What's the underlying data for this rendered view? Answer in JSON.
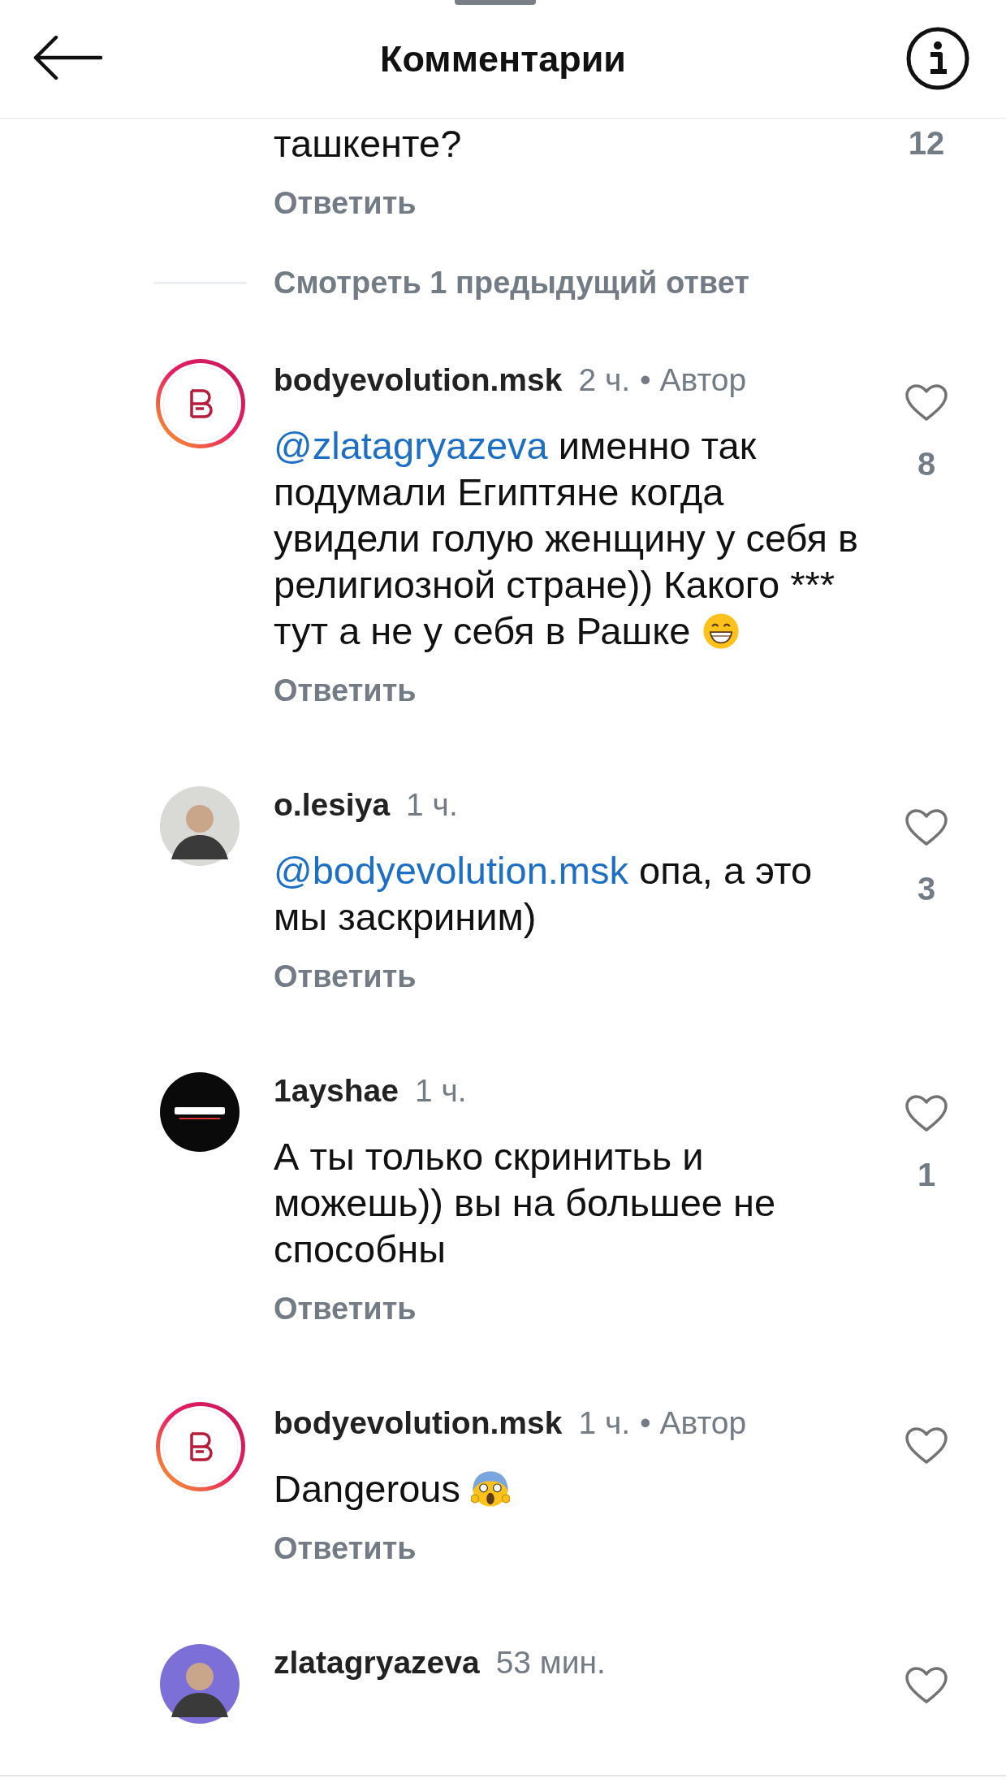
{
  "header": {
    "title": "Комментарии"
  },
  "partial_comment": {
    "text": "ташкенте?",
    "likes": "12",
    "reply": "Ответить"
  },
  "view_replies": "Смотреть 1 предыдущий ответ",
  "comments": [
    {
      "user": "bodyevolution.msk",
      "time": "2 ч.",
      "author_label": "• Автор",
      "avatar": {
        "kind": "ring-logo"
      },
      "mention": "@zlatagryazeva",
      "text": "именно так подумали Египтяне когда увидели голую женщину у себя в религиозной стране)) Какого *** тут а не у себя в Рашке",
      "emoji": {
        "kind": "grin"
      },
      "likes": "8",
      "reply": "Ответить"
    },
    {
      "user": "o.lesiya",
      "time": "1 ч.",
      "avatar": {
        "kind": "photo",
        "color": "#d9d9d6"
      },
      "mention": "@bodyevolution.msk",
      "text": "опа, а это мы заскриним)",
      "likes": "3",
      "reply": "Ответить"
    },
    {
      "user": "1ayshae",
      "time": "1 ч.",
      "avatar": {
        "kind": "black-logo"
      },
      "text": "А ты только скринитьь и можешь)) вы на большее не способны",
      "likes": "1",
      "reply": "Ответить"
    },
    {
      "user": "bodyevolution.msk",
      "time": "1 ч.",
      "author_label": "• Автор",
      "avatar": {
        "kind": "ring-logo"
      },
      "text": "Dangerous",
      "emoji": {
        "kind": "scream"
      },
      "reply": "Ответить"
    },
    {
      "user": "zlatagryazeva",
      "time": "53 мин.",
      "avatar": {
        "kind": "photo",
        "color": "#7d6fd8"
      }
    }
  ]
}
